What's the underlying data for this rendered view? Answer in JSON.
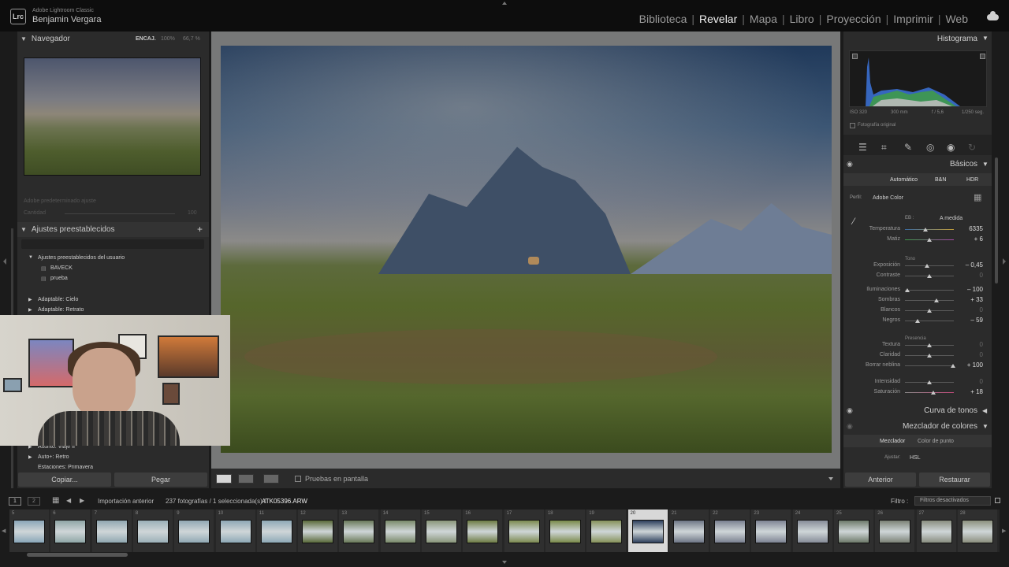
{
  "brand": {
    "product": "Adobe Lightroom Classic",
    "user": "Benjamin Vergara",
    "logo": "Lrc"
  },
  "modules": [
    "Biblioteca",
    "Revelar",
    "Mapa",
    "Libro",
    "Proyección",
    "Imprimir",
    "Web"
  ],
  "active_module": "Revelar",
  "navigator": {
    "title": "Navegador",
    "fit": "ENCAJ.",
    "zoom1": "100%",
    "zoom2": "66,7 %"
  },
  "faded": {
    "line1": "Adobe predeterminado ajuste",
    "line2": "Cantidad",
    "line3": "100"
  },
  "presets": {
    "title": "Ajustes preestablecidos",
    "user_group": "Ajustes preestablecidos del usuario",
    "user_items": [
      "BAVECK",
      "prueba"
    ],
    "groups": [
      "Adaptable: Cielo",
      "Adaptable: Retrato"
    ],
    "groups_bottom": [
      "Asunto: Viaje II",
      "Auto+: Retro",
      "Estaciones: Primavera"
    ]
  },
  "left_buttons": {
    "copy": "Copiar...",
    "paste": "Pegar"
  },
  "toolbar": {
    "softproof": "Pruebas en pantalla"
  },
  "histogram": {
    "title": "Histograma",
    "iso": "ISO 320",
    "focal": "300 mm",
    "aperture": "f / 5,6",
    "shutter": "1/250 seg.",
    "original": "Fotografía original"
  },
  "basics": {
    "title": "Básicos",
    "auto": "Automático",
    "bw": "B&N",
    "hdr": "HDR",
    "profile_label": "Perfil:",
    "profile": "Adobe Color",
    "wb_label": "EB :",
    "wb_value": "A medida",
    "tone_label": "Tono",
    "presence_label": "Presencia",
    "sliders": [
      {
        "label": "Temperatura",
        "value": "6335"
      },
      {
        "label": "Matiz",
        "value": "+ 6"
      },
      {
        "label": "Exposición",
        "value": "– 0,45"
      },
      {
        "label": "Contraste",
        "value": "0"
      },
      {
        "label": "Iluminaciones",
        "value": "– 100"
      },
      {
        "label": "Sombras",
        "value": "+ 33"
      },
      {
        "label": "Blancos",
        "value": "0"
      },
      {
        "label": "Negros",
        "value": "– 59"
      },
      {
        "label": "Textura",
        "value": "0"
      },
      {
        "label": "Claridad",
        "value": "0"
      },
      {
        "label": "Borrar neblina",
        "value": "+ 100"
      },
      {
        "label": "Intensidad",
        "value": "0"
      },
      {
        "label": "Saturación",
        "value": "+ 18"
      }
    ]
  },
  "tone_curve": {
    "title": "Curva de tonos"
  },
  "color_mixer": {
    "title": "Mezclador de colores",
    "tab1": "Mezclador",
    "tab2": "Color de punto",
    "adjust_label": "Ajustar:",
    "adjust_value": "HSL"
  },
  "right_buttons": {
    "prev": "Anterior",
    "reset": "Restaurar"
  },
  "filmstrip_bar": {
    "view1": "1",
    "view2": "2",
    "source": "Importación anterior",
    "count": "237 fotografías / 1 seleccionada(s) /",
    "file": "ATK05396.ARW",
    "filter_label": "Filtro :",
    "filter_value": "Filtros desactivados"
  },
  "filmstrip": {
    "numbers": [
      "5",
      "6",
      "7",
      "8",
      "9",
      "10",
      "11",
      "12",
      "13",
      "14",
      "15",
      "16",
      "17",
      "18",
      "19",
      "20",
      "21",
      "22",
      "23",
      "24",
      "25",
      "26",
      "27",
      "28"
    ],
    "selected_index": 15
  },
  "colors": {
    "accent_active": "#f2f2f2",
    "panel": "#2b2b2b"
  }
}
